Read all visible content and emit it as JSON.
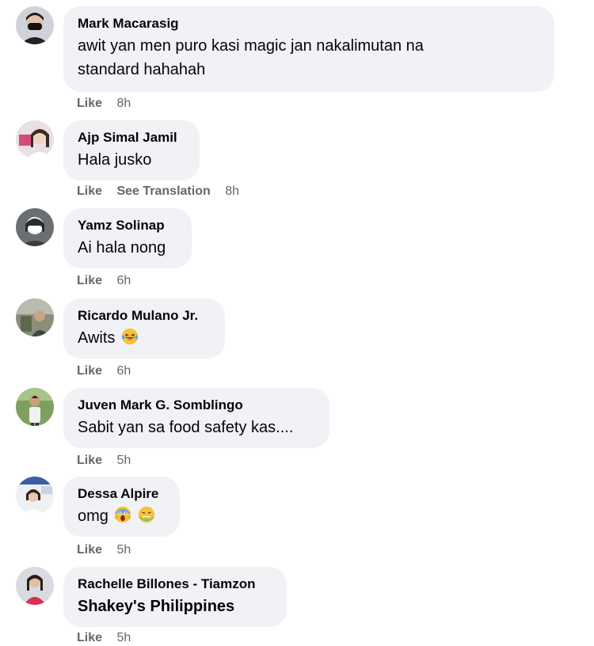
{
  "comments": [
    {
      "author": "Mark Macarasig",
      "text_line1": "awit yan men puro kasi magic jan nakalimutan na",
      "text_line2": "standard hahahah",
      "like_label": "Like",
      "time": "8h",
      "avatar_icon": "profile-photo-icon"
    },
    {
      "author": "Ajp Simal Jamil",
      "text": "Hala jusko",
      "like_label": "Like",
      "see_translation_label": "See Translation",
      "time": "8h",
      "avatar_icon": "profile-photo-icon"
    },
    {
      "author": "Yamz Solinap",
      "text": "Ai hala nong",
      "like_label": "Like",
      "time": "6h",
      "avatar_icon": "profile-photo-icon"
    },
    {
      "author": "Ricardo Mulano Jr.",
      "text": "Awits",
      "emoji": "laughing-crying-emoji",
      "like_label": "Like",
      "time": "6h",
      "avatar_icon": "profile-photo-icon"
    },
    {
      "author": "Juven Mark G. Somblingo",
      "text": "Sabit yan sa food safety kas....",
      "like_label": "Like",
      "time": "5h",
      "avatar_icon": "profile-photo-icon"
    },
    {
      "author": "Dessa Alpire",
      "text": "omg",
      "emojis": [
        "screaming-emoji",
        "nauseated-emoji"
      ],
      "like_label": "Like",
      "time": "5h",
      "avatar_icon": "profile-photo-icon"
    },
    {
      "author": "Rachelle Billones - Tiamzon",
      "text": "Shakey's Philippines",
      "like_label": "Like",
      "time": "5h",
      "avatar_icon": "profile-photo-icon"
    }
  ],
  "colors": {
    "bubble_bg": "#f0f2f5",
    "meta_text": "#65676b",
    "primary_text": "#050505"
  }
}
